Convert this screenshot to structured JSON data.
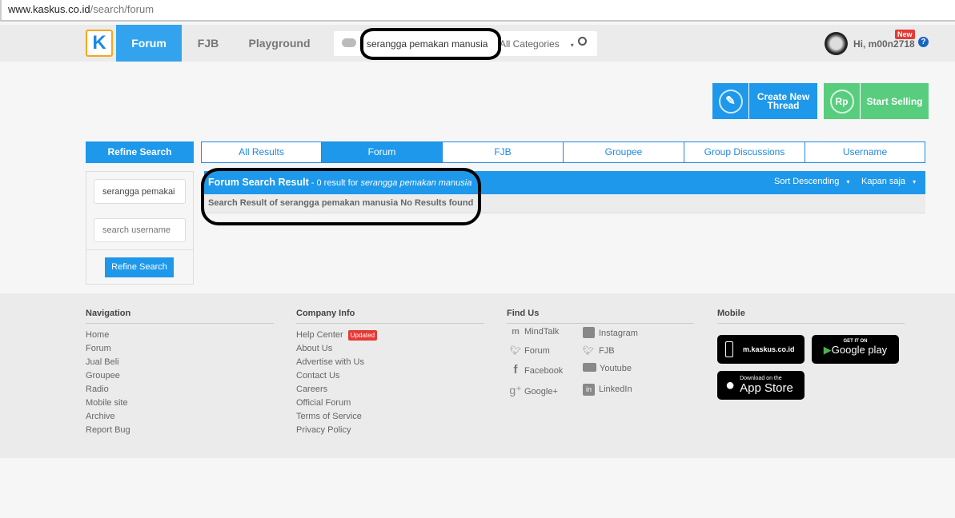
{
  "browser": {
    "url_domain": "www.kaskus.co.id",
    "url_path": "/search/forum"
  },
  "header": {
    "logo": "K",
    "nav": [
      "Forum",
      "FJB",
      "Playground"
    ],
    "search_value": "serangga pemakan manusia",
    "category": "All Categories",
    "user": "Hi, m00n2718",
    "new_badge": "New"
  },
  "actions": {
    "create": "Create New Thread",
    "sell": "Start Selling"
  },
  "sidebar": {
    "title": "Refine Search",
    "keyword_value": "serangga pemakai",
    "username_placeholder": "search username",
    "button": "Refine Search"
  },
  "tabs": [
    "All Results",
    "Forum",
    "FJB",
    "Groupee",
    "Group Discussions",
    "Username"
  ],
  "results": {
    "title": "Forum Search Result",
    "count_text": " - 0 result for ",
    "query": "serangga pemakan manusia",
    "sort": "Sort Descending",
    "time": "Kapan saja",
    "message": "Search Result of serangga pemakan manusia No Results found"
  },
  "footer": {
    "navigation": {
      "title": "Navigation",
      "links": [
        "Home",
        "Forum",
        "Jual Beli",
        "Groupee",
        "Radio",
        "Mobile site",
        "Archive",
        "Report Bug"
      ]
    },
    "company": {
      "title": "Company Info",
      "links": [
        "Help Center",
        "About Us",
        "Advertise with Us",
        "Contact Us",
        "Careers",
        "Official Forum",
        "Terms of Service",
        "Privacy Policy"
      ],
      "updated": "Updated"
    },
    "findus": {
      "title": "Find Us",
      "links": [
        "MindTalk",
        "Instagram",
        "Forum",
        "FJB",
        "Facebook",
        "Youtube",
        "Google+",
        "LinkedIn"
      ]
    },
    "mobile": {
      "title": "Mobile",
      "msite": "m.kaskus.co.id",
      "gp_top": "GET IT ON",
      "gp": "Google play",
      "as_top": "Download on the",
      "as": "App Store"
    }
  },
  "colors": {
    "primary": "#1e98ea",
    "green": "#58cd7e",
    "red": "#e53935"
  }
}
